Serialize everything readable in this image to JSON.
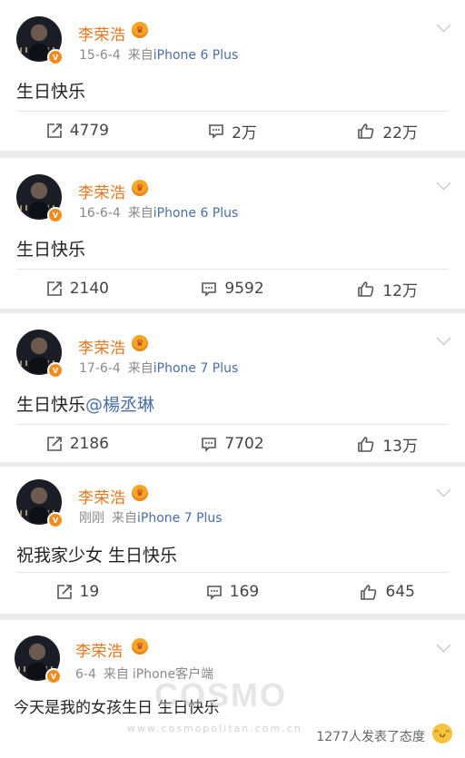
{
  "posts": [
    {
      "user": "李荣浩",
      "time": "15-6-4",
      "source_prefix": "来自",
      "device": "iPhone 6 Plus",
      "text": "生日快乐",
      "mention": "",
      "reposts": "4779",
      "comments": "2万",
      "likes": "22万"
    },
    {
      "user": "李荣浩",
      "time": "16-6-4",
      "source_prefix": "来自",
      "device": "iPhone 6 Plus",
      "text": "生日快乐",
      "mention": "",
      "reposts": "2140",
      "comments": "9592",
      "likes": "12万"
    },
    {
      "user": "李荣浩",
      "time": "17-6-4",
      "source_prefix": "来自",
      "device": "iPhone 7 Plus",
      "text": "生日快乐",
      "mention": "@楊丞琳",
      "reposts": "2186",
      "comments": "7702",
      "likes": "13万"
    },
    {
      "user": "李荣浩",
      "time": "刚刚",
      "source_prefix": "来自",
      "device": "iPhone 7 Plus",
      "text": "祝我家少女 生日快乐",
      "mention": "",
      "reposts": "19",
      "comments": "169",
      "likes": "645"
    },
    {
      "user": "李荣浩",
      "time": "6-4",
      "source_prefix": "来自",
      "device": "iPhone客户端",
      "text": "今天是我的女孩生日 生日快乐",
      "mention": ""
    }
  ],
  "footer": {
    "reaction_text": "1277人发表了态度"
  },
  "watermark": {
    "brand": "COSMO",
    "url": "www.cosmopolitan.com.cn"
  },
  "icons": {
    "verified": "verified-badge-icon",
    "crown": "member-crown-icon",
    "more": "chevron-down-icon",
    "repost": "repost-icon",
    "comment": "comment-icon",
    "like": "thumbs-up-icon",
    "emoji": "grin-emoji-icon"
  },
  "colors": {
    "name": "#e8741c",
    "link": "#4a6fa5",
    "badge": "#f28c1e",
    "background": "#ececec"
  }
}
